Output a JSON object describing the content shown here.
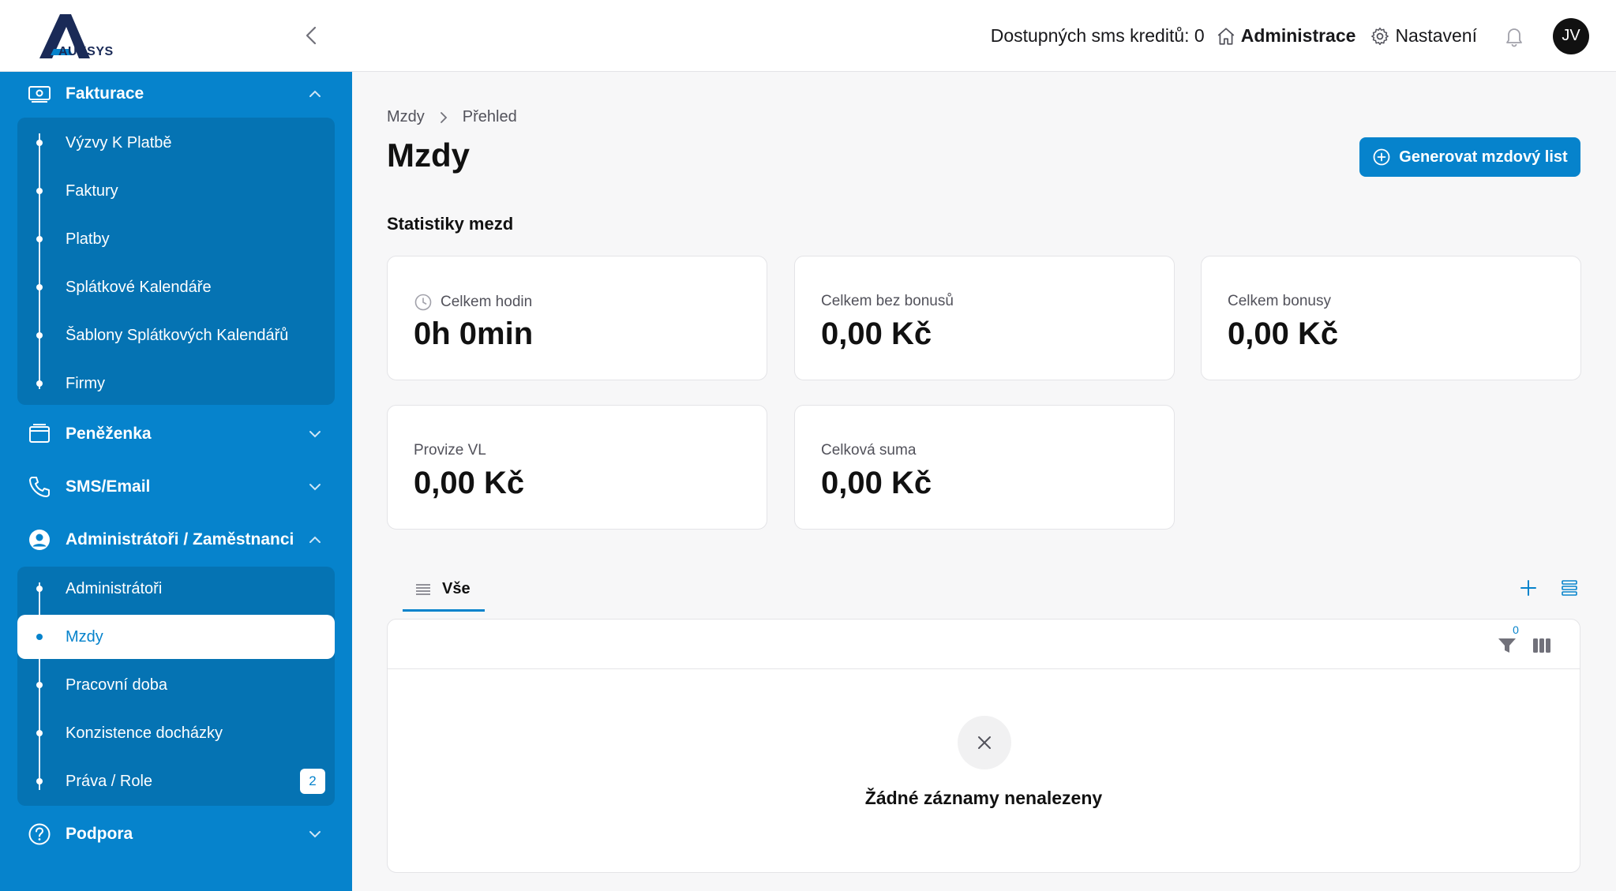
{
  "header": {
    "logo_text": "AUKSYS",
    "sms_credits": "Dostupných sms kreditů: 0",
    "administrace": "Administrace",
    "nastaveni": "Nastavení",
    "avatar_initials": "JV"
  },
  "sidebar": {
    "fakturace": {
      "label": "Fakturace",
      "items": [
        "Výzvy K Platbě",
        "Faktury",
        "Platby",
        "Splátkové Kalendáře",
        "Šablony Splátkových Kalendářů",
        "Firmy"
      ]
    },
    "penezenka": {
      "label": "Peněženka"
    },
    "sms_email": {
      "label": "SMS/Email"
    },
    "admins": {
      "label": "Administrátoři / Zaměstnanci",
      "items": [
        "Administrátoři",
        "Mzdy",
        "Pracovní doba",
        "Konzistence docházky",
        "Práva / Role"
      ],
      "active": "Mzdy",
      "roles_badge": "2"
    },
    "podpora": {
      "label": "Podpora"
    }
  },
  "main": {
    "breadcrumb": [
      "Mzdy",
      "Přehled"
    ],
    "title": "Mzdy",
    "generate_button": "Generovat mzdový list",
    "stats_title": "Statistiky mezd",
    "stats": [
      {
        "label": "Celkem hodin",
        "value": "0h 0min"
      },
      {
        "label": "Celkem bez bonusů",
        "value": "0,00 Kč"
      },
      {
        "label": "Celkem bonusy",
        "value": "0,00 Kč"
      },
      {
        "label": "Provize VL",
        "value": "0,00 Kč"
      },
      {
        "label": "Celková suma",
        "value": "0,00 Kč"
      }
    ],
    "tab_all": "Vše",
    "filter_count": "0",
    "empty_message": "Žádné záznamy nenalezeny"
  },
  "colors": {
    "brand": "#0683cc",
    "brand_dark": "#0573b3"
  },
  "icons": {
    "header": [
      "home-icon",
      "gear-icon",
      "bell-icon"
    ],
    "sidebar": [
      "invoice-icon",
      "wallet-icon",
      "phone-icon",
      "user-circle-icon",
      "help-icon"
    ],
    "main": [
      "clock-icon",
      "plus-circle-icon",
      "list-icon",
      "plus-icon",
      "rows-icon",
      "filter-icon",
      "columns-icon",
      "close-icon"
    ]
  }
}
